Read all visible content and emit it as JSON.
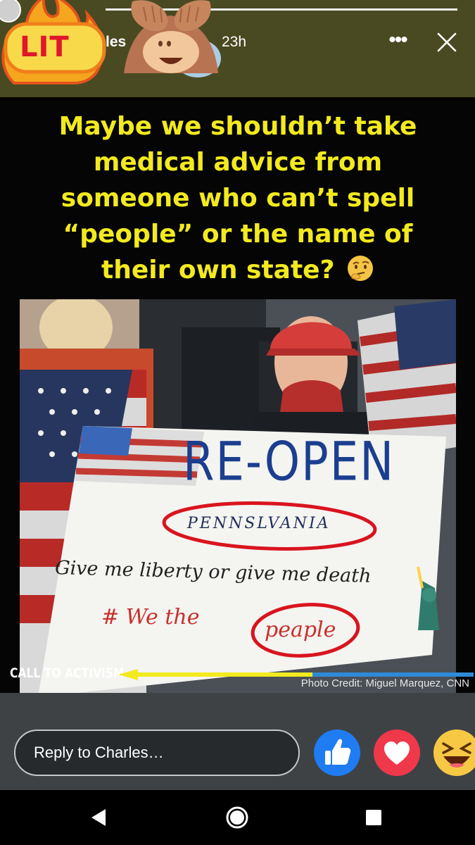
{
  "header": {
    "user_name": "les",
    "time_ago": "23h",
    "progress": 1.0,
    "more_icon": "more-horizontal-icon",
    "close_icon": "close-icon"
  },
  "stickers": {
    "lit": "LIT",
    "monkey": "see-no-evil-monkey"
  },
  "post": {
    "caption_lines": [
      "Maybe we shouldn’t take",
      "medical advice from",
      "someone who can’t spell",
      "“people” or the name of",
      "their own state?"
    ],
    "sign_title": "RE-OPEN",
    "sign_state": "PENNSLVANIA",
    "sign_slogan": "Give me liberty or give me death",
    "sign_hashtag_hash": "# We the",
    "sign_hashtag_word": "peaple",
    "activism_label": "CALL TO ACTIVISM",
    "photo_credit": "Photo Credit: Miguel Marquez, CNN"
  },
  "reply": {
    "placeholder": "Reply to Charles…"
  },
  "reactions": [
    "like",
    "love",
    "haha"
  ],
  "colors": {
    "caption": "#f2ea1e",
    "header_bg": "#4a4a22",
    "like": "#1f7cf2",
    "love": "#f0384b",
    "haha": "#f7c843",
    "highlight_circle": "#d9141e"
  },
  "navbar": [
    "back-icon",
    "home-icon",
    "recents-icon"
  ]
}
